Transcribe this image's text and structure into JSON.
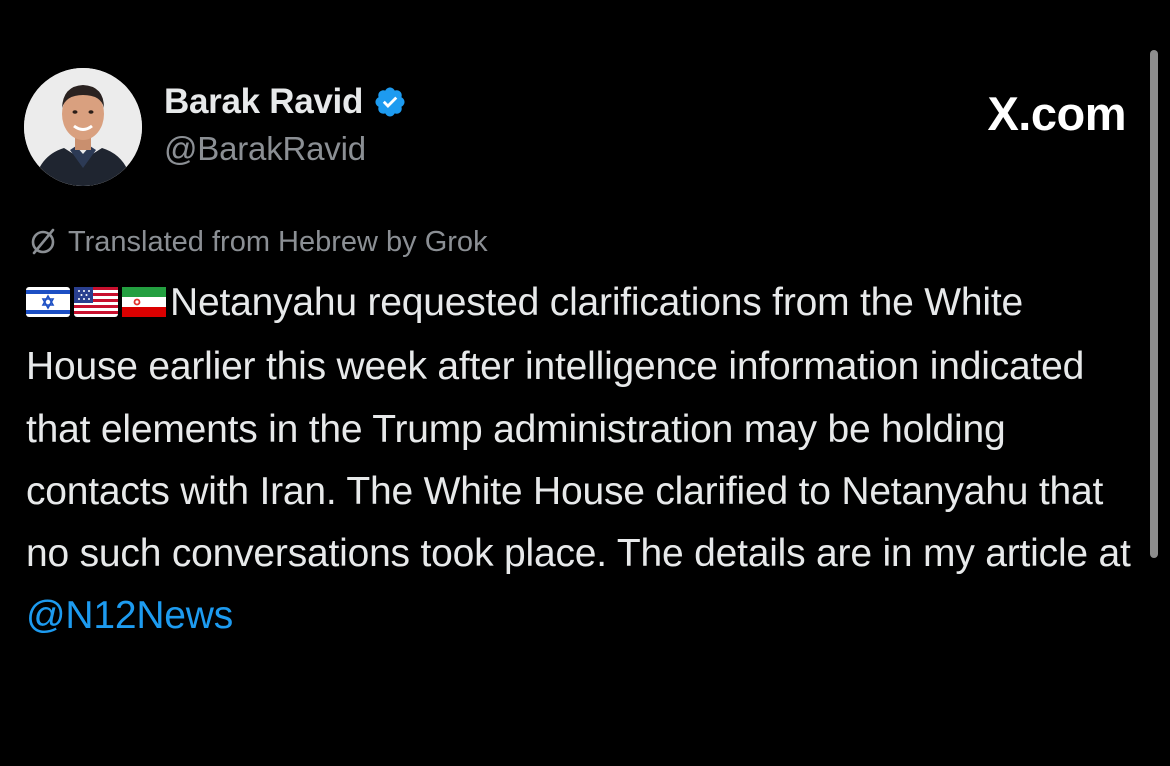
{
  "author": {
    "display_name": "Barak Ravid",
    "handle": "@BarakRavid",
    "verified": true
  },
  "brand": {
    "label": "X.com"
  },
  "translation": {
    "label": "Translated from Hebrew by Grok",
    "icon": "translate-icon"
  },
  "tweet": {
    "flags": [
      "israel-flag-icon",
      "usa-flag-icon",
      "iran-flag-icon"
    ],
    "text": "Netanyahu requested clarifications from the White House earlier this week after intelligence information indicated that elements in the Trump administration may be holding contacts with Iran. The White House clarified to Netanyahu that no such conversations took place. The details are in my article at ",
    "mention": "@N12News"
  },
  "colors": {
    "background": "#000000",
    "text": "#e7e9ea",
    "secondary": "#8b8f94",
    "link": "#1d9bf0",
    "verified": "#1d9bf0"
  }
}
